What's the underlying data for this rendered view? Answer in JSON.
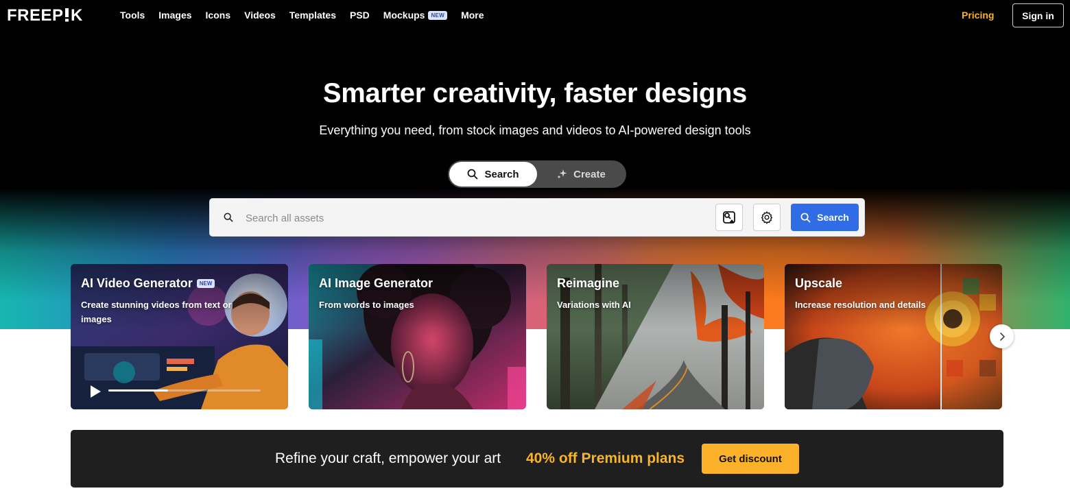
{
  "brand": {
    "logo_text": "FREEPIK"
  },
  "nav": {
    "items": [
      {
        "label": "Tools"
      },
      {
        "label": "Images"
      },
      {
        "label": "Icons"
      },
      {
        "label": "Videos"
      },
      {
        "label": "Templates"
      },
      {
        "label": "PSD"
      },
      {
        "label": "Mockups",
        "badge": "NEW"
      },
      {
        "label": "More"
      }
    ],
    "pricing_label": "Pricing",
    "signin_label": "Sign in"
  },
  "hero": {
    "title": "Smarter creativity, faster designs",
    "subtitle": "Everything you need, from stock images and videos to AI-powered design tools",
    "mode_toggle": {
      "active": "search",
      "search_label": "Search",
      "create_label": "Create"
    },
    "search": {
      "placeholder": "Search all assets",
      "value": "",
      "button_label": "Search"
    }
  },
  "cards": [
    {
      "title": "AI Video Generator",
      "badge": "NEW",
      "description": "Create stunning videos from text or images",
      "video_progress": 0.39
    },
    {
      "title": "AI Image Generator",
      "description": "From words to images"
    },
    {
      "title": "Reimagine",
      "description": "Variations with AI"
    },
    {
      "title": "Upscale",
      "description": "Increase resolution and details"
    }
  ],
  "promo": {
    "text": "Refine your craft, empower your art",
    "offer": "40% off Premium plans",
    "button_label": "Get discount"
  },
  "colors": {
    "accent_blue": "#2f6ce5",
    "pricing_yellow": "#f7b52c",
    "cta_yellow": "#fcb12a",
    "nav_badge_bg": "#dbe4ff"
  },
  "icons": {
    "search": "search-icon",
    "create": "sparkle-icon",
    "image_search": "image-search-icon",
    "settings": "gear-icon",
    "next": "chevron-right-icon",
    "play": "play-icon"
  }
}
